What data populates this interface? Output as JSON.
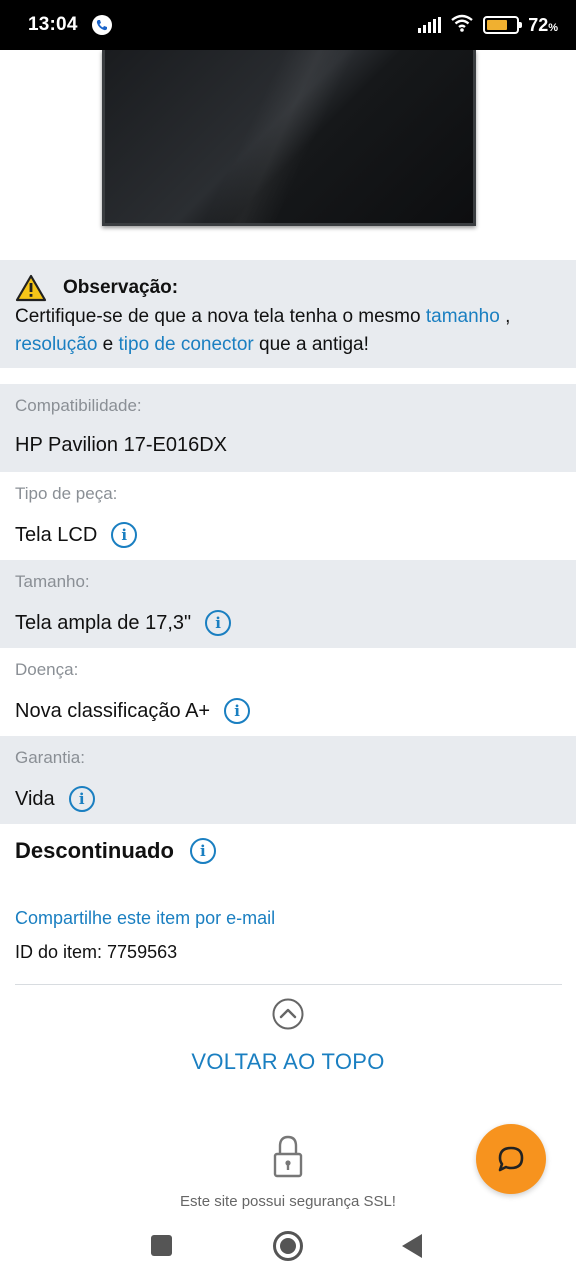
{
  "status_bar": {
    "time": "13:04",
    "battery": "72",
    "battery_unit": "%",
    "icons": [
      "call-icon",
      "signal-icon",
      "wifi-icon",
      "battery-icon"
    ]
  },
  "note": {
    "title": "Observação:",
    "text_before": "Certifique-se de que a nova tela tenha o mesmo ",
    "link_size": "tamanho",
    "sep1": " ,",
    "link_resolution": "resolução",
    "sep2": " e ",
    "link_connector": "tipo de conector",
    "text_after": " que a antiga!"
  },
  "specs": [
    {
      "label": "Compatibilidade:",
      "value": "HP Pavilion 17-E016DX"
    },
    {
      "label": "Tipo de peça:",
      "value": "Tela LCD"
    },
    {
      "label": "Tamanho:",
      "value": "Tela ampla de 17,3\""
    },
    {
      "label": "Doença:",
      "value": "Nova classificação A+"
    },
    {
      "label": "Garantia:",
      "value": "Vida"
    }
  ],
  "discontinued": "Descontinuado",
  "share_link": "Compartilhe este item por e-mail",
  "item_id": "ID do item: 7759563",
  "back_to_top": "VOLTAR AO TOPO",
  "ssl_text": "Este site possui segurança SSL!",
  "colors": {
    "link": "#1a7fc1",
    "chat_button": "#f7931e",
    "shaded_row": "#e8ebef"
  }
}
